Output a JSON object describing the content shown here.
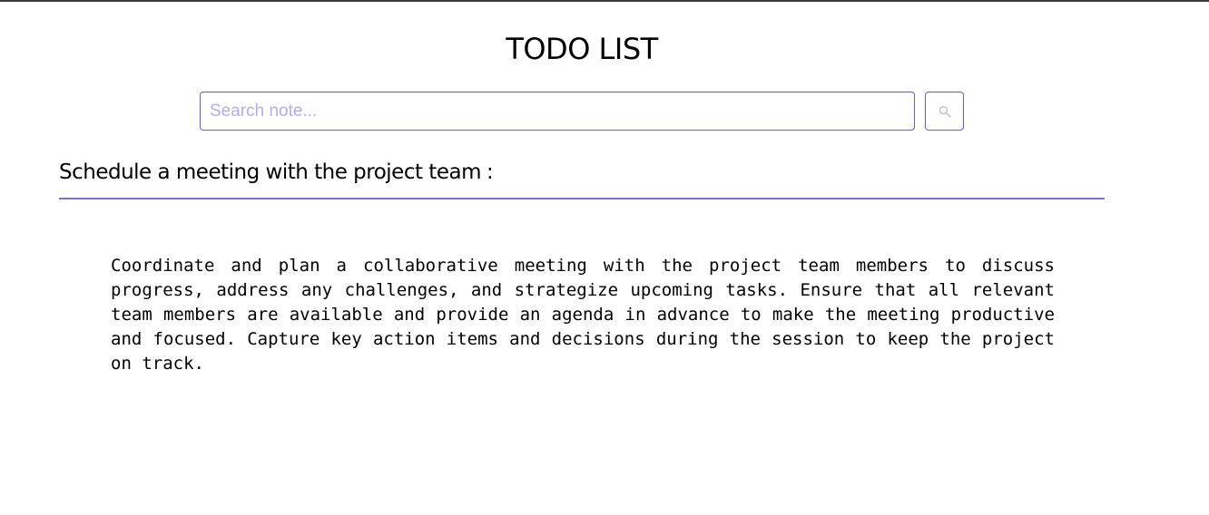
{
  "app": {
    "title": "TODO LIST"
  },
  "search": {
    "placeholder": "Search note...",
    "value": "",
    "button_icon": "search-icon"
  },
  "notes": [
    {
      "title": "Schedule a meeting with the project team",
      "separator": ":",
      "body": "Coordinate and plan a collaborative meeting with the project team members to discuss progress, address any challenges, and strategize upcoming tasks. Ensure that all relevant team members are available and provide an agenda in advance to make the meeting productive and focused. Capture key action items and decisions during the session to keep the project on track."
    }
  ],
  "colors": {
    "accent": "#6a5acd",
    "placeholder": "#b4acf0",
    "divider": "#7b6fd6"
  }
}
